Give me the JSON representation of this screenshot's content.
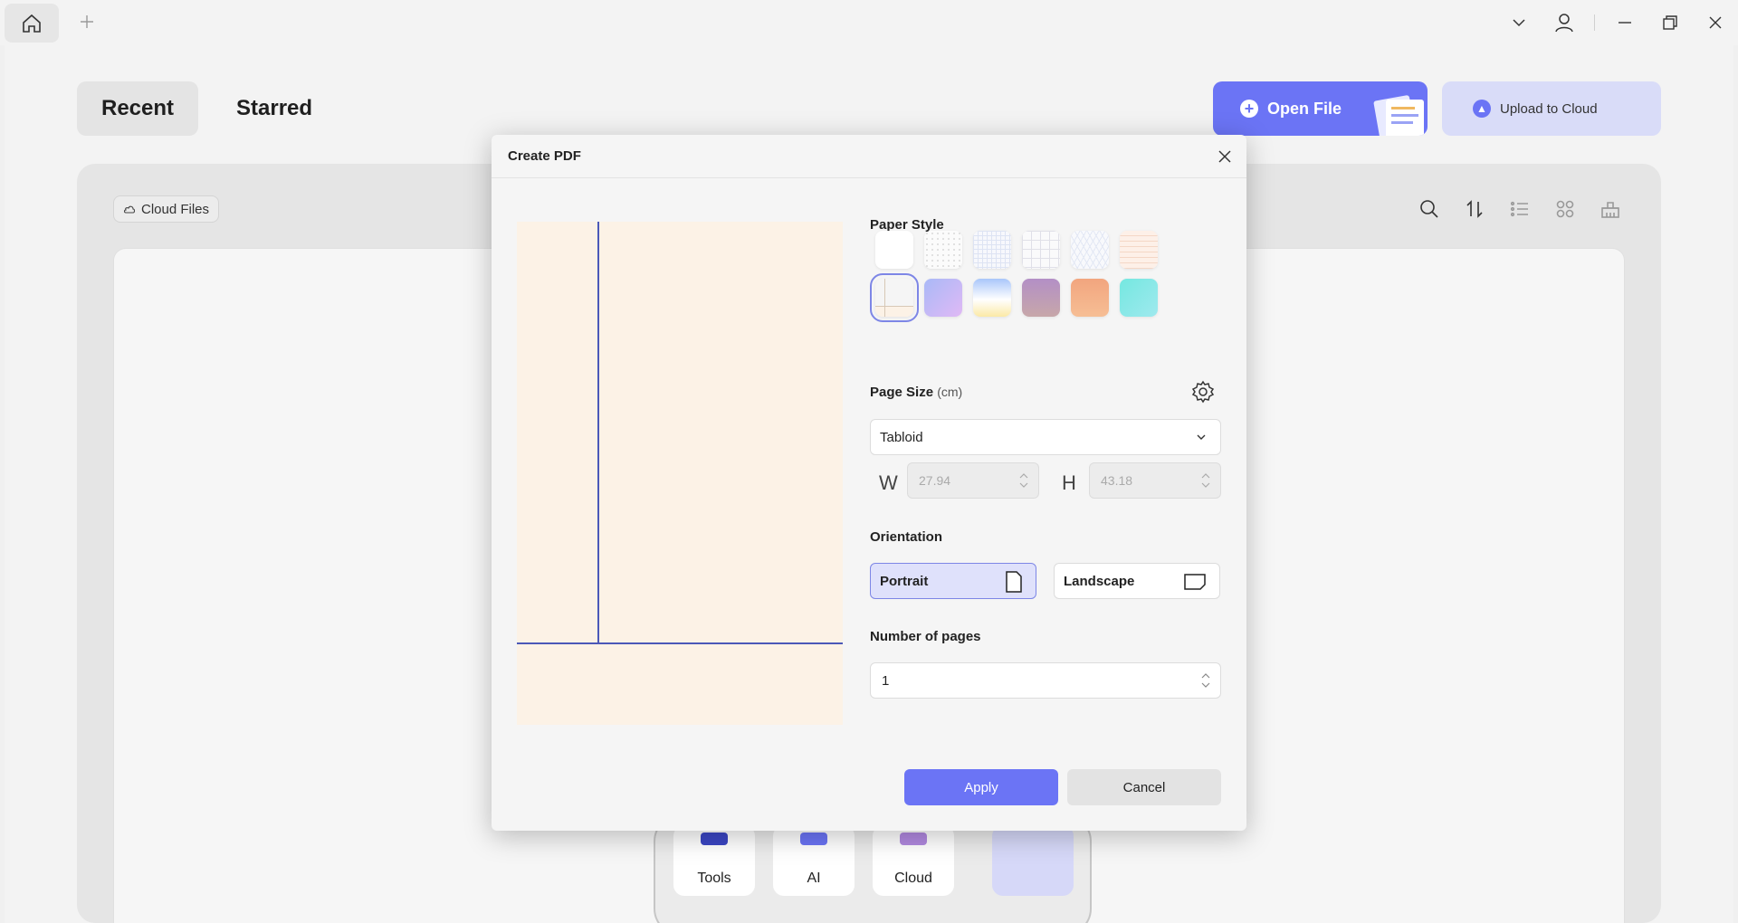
{
  "window": {
    "tab_add_icon": "plus-icon"
  },
  "home": {
    "tabs": [
      {
        "label": "Recent",
        "active": true
      },
      {
        "label": "Starred",
        "active": false
      }
    ],
    "open_file_label": "Open File",
    "upload_label": "Upload to Cloud",
    "cloud_files_label": "Cloud Files",
    "dock": [
      {
        "label": "Tools",
        "color": "#3b46c4"
      },
      {
        "label": "AI",
        "color": "#6b74f5"
      },
      {
        "label": "Cloud",
        "color": "#b189e0"
      }
    ]
  },
  "dialog": {
    "title": "Create PDF",
    "paper_style_label": "Paper Style",
    "paper_styles": [
      {
        "name": "blank",
        "color": "#ffffff"
      },
      {
        "name": "dots",
        "color": "#fbfbfb"
      },
      {
        "name": "fine-grid",
        "color": "#f4f6fb"
      },
      {
        "name": "grid",
        "color": "#f7f7f9"
      },
      {
        "name": "isometric",
        "color": "#f4f6fb"
      },
      {
        "name": "lined-peach",
        "color": "#fdf0e8"
      },
      {
        "name": "cornell",
        "color": "#fcf2e6",
        "selected": true
      },
      {
        "name": "lavender",
        "color": "#c9b3f5"
      },
      {
        "name": "sky",
        "color": "#c9dcfa"
      },
      {
        "name": "mauve",
        "color": "#b69bc0"
      },
      {
        "name": "peach",
        "color": "#f5ae88"
      },
      {
        "name": "aqua",
        "color": "#86e6e4"
      }
    ],
    "page_size_label": "Page Size",
    "page_size_unit": "(cm)",
    "page_size_value": "Tabloid",
    "width_label": "W",
    "width_value": "27.94",
    "height_label": "H",
    "height_value": "43.18",
    "orientation_label": "Orientation",
    "portrait_label": "Portrait",
    "landscape_label": "Landscape",
    "orientation_selected": "Portrait",
    "pages_label": "Number of pages",
    "pages_value": "1",
    "apply_label": "Apply",
    "cancel_label": "Cancel"
  }
}
